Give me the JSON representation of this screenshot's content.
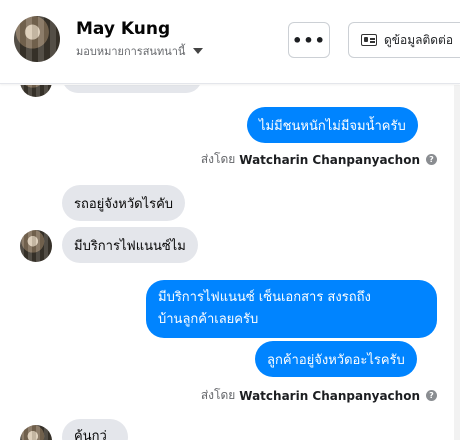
{
  "header": {
    "contact_name": "May Kung",
    "assign_label": "มอบหมายการสนทนานี้",
    "more_label": "•••",
    "contact_button_label": "ดูข้อมูลติดต่อ"
  },
  "messages": {
    "m1": "ไม่มีชนหนักไม่มีจมน้ำครับ",
    "m2": "รถอยู่จังหวัดไรคับ",
    "m3": "มีบริการไฟแนนซ์ไม",
    "m4_line1": "มีบริการไฟแนนซ์ เซ็นเอกสาร สงรถถึง",
    "m4_line2": "บ้านลูกค้าเลยครับ",
    "m5": "ลูกค้าอยู่จังหวัดอะไรครับ",
    "m6_partial": "ค้นกว่"
  },
  "sent_by": {
    "prefix": "ส่งโดย",
    "agent": "Watcharin Chanpanyachon",
    "help_glyph": "?"
  },
  "colors": {
    "outgoing_bubble": "#0084ff",
    "incoming_bubble": "#e4e6eb",
    "secondary_text": "#65676b"
  }
}
